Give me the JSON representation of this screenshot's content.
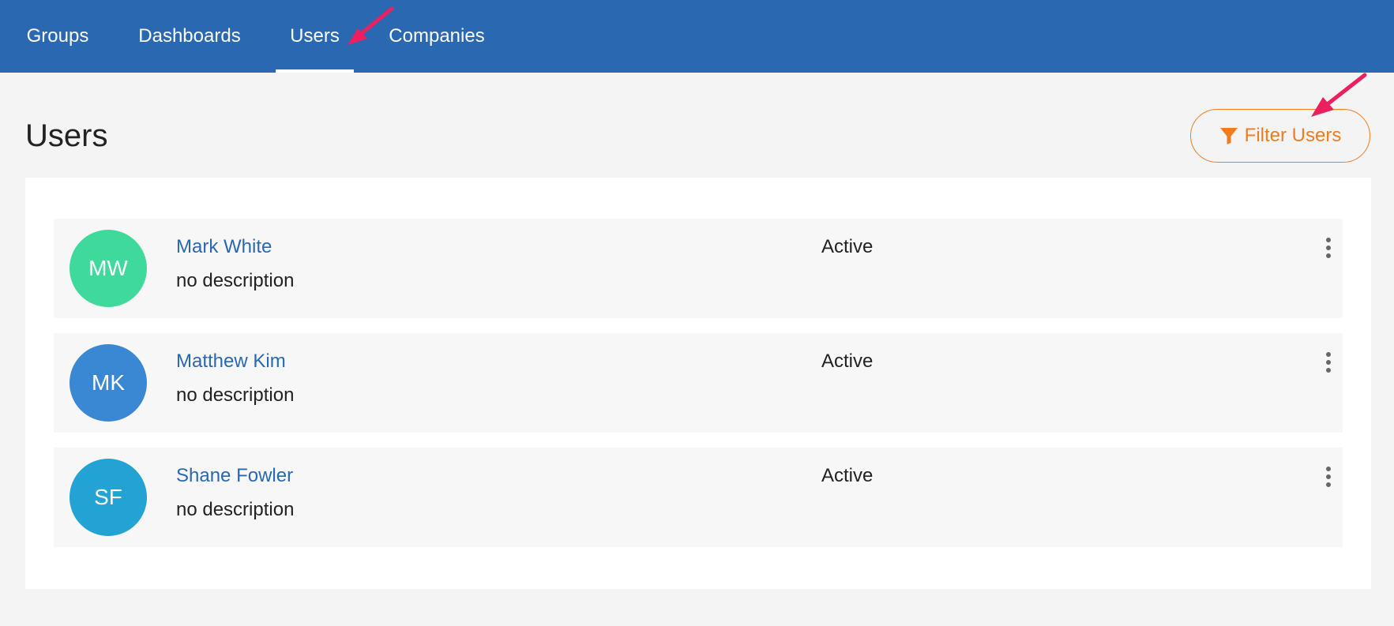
{
  "nav": {
    "tabs": [
      {
        "label": "Groups"
      },
      {
        "label": "Dashboards"
      },
      {
        "label": "Users"
      },
      {
        "label": "Companies"
      }
    ],
    "active": "Users"
  },
  "page": {
    "title": "Users",
    "filter_label": "Filter Users"
  },
  "users": [
    {
      "initials": "MW",
      "name": "Mark White",
      "description": "no description",
      "status": "Active",
      "avatar_color": "#3fd99c"
    },
    {
      "initials": "MK",
      "name": "Matthew Kim",
      "description": "no description",
      "status": "Active",
      "avatar_color": "#3a87d3"
    },
    {
      "initials": "SF",
      "name": "Shane Fowler",
      "description": "no description",
      "status": "Active",
      "avatar_color": "#22a3d4"
    }
  ],
  "colors": {
    "header_blue": "#2a68b1",
    "accent_orange": "#f07c1f",
    "annotation_pink": "#ee1f5f"
  },
  "icons": {
    "filter": "filter-icon",
    "more": "more-vertical-icon"
  }
}
